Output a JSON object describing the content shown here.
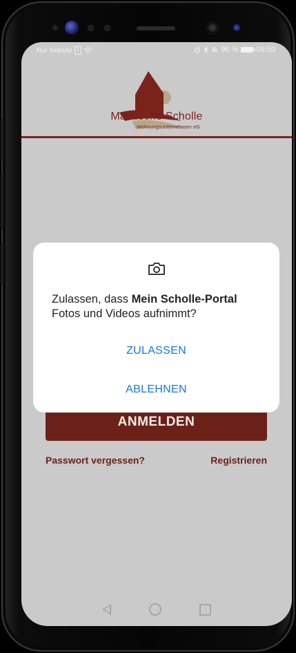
{
  "status_bar": {
    "carrier": "Nur Notrufe",
    "sim_label": "1",
    "battery_percent": "96 %",
    "time": "09:50"
  },
  "brand": {
    "name": "Märkische Scholle",
    "tagline": "Wohnungsunternehmen eG",
    "colors": {
      "primary": "#6b2118",
      "accent": "#b7a78a"
    }
  },
  "login": {
    "button_label": "ANMELDEN",
    "forgot_password": "Passwort vergessen?",
    "register": "Registrieren"
  },
  "permission_dialog": {
    "icon": "camera-icon",
    "message_prefix": "Zulassen, dass ",
    "app_name": "Mein Scholle-Portal",
    "message_suffix": "Fotos und Videos aufnimmt?",
    "allow_label": "ZULASSEN",
    "deny_label": "ABLEHNEN",
    "action_color": "#1a73e8"
  },
  "nav_bar": {
    "icons": [
      "back-icon",
      "home-icon",
      "recent-apps-icon"
    ]
  }
}
